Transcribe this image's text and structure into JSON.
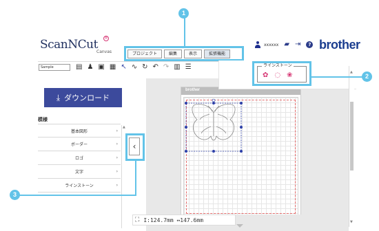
{
  "header": {
    "logo_text": "ScanNCut",
    "logo_sub": "Canvas",
    "user_name": "xxxxxx",
    "brand": "brother"
  },
  "menu": {
    "tabs": [
      "プロジェクト",
      "編集",
      "表示",
      "拡張機能"
    ],
    "active_index": 3
  },
  "toolbar": {
    "project_name": "Sample",
    "icons": [
      "new-file-icon",
      "save-user-icon",
      "folder-icon",
      "image-icon",
      "pointer-icon",
      "pen-icon",
      "rotate-icon",
      "undo-icon",
      "redo-icon",
      "trash-icon",
      "menu-icon"
    ]
  },
  "rhinestone": {
    "title": "ラインストーン",
    "icons": [
      "rhinestone-brush-icon",
      "rhinestone-circle-icon",
      "rhinestone-fill-icon"
    ]
  },
  "left_panel": {
    "download_label": "ダウンロード",
    "section_title": "模様",
    "categories": [
      "基本図形",
      "ボーダー",
      "ロゴ",
      "文字",
      "ラインストーン"
    ]
  },
  "canvas": {
    "sheet_brand": "brother",
    "status_size": "I:124.7mm  ↔147.6mm"
  },
  "callouts": [
    "1",
    "2",
    "3"
  ],
  "colors": {
    "accent": "#62c3e8",
    "primary": "#3c4a9c",
    "brand": "#1a3d8f",
    "rhinestone": "#d63573"
  }
}
